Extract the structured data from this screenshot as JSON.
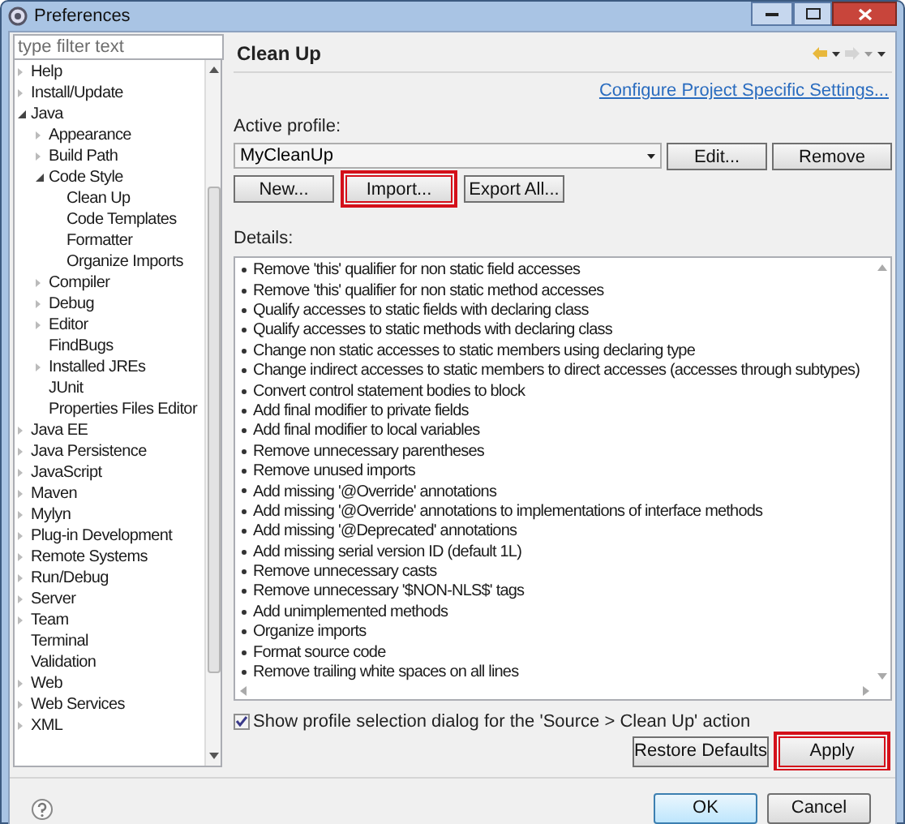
{
  "window": {
    "title": "Preferences"
  },
  "filter": {
    "placeholder": "type filter text"
  },
  "tree": [
    {
      "label": "Help",
      "expanded": false
    },
    {
      "label": "Install/Update",
      "expanded": false
    },
    {
      "label": "Java",
      "expanded": true,
      "children": [
        {
          "label": "Appearance",
          "expanded": false
        },
        {
          "label": "Build Path",
          "expanded": false
        },
        {
          "label": "Code Style",
          "expanded": true,
          "children": [
            {
              "label": "Clean Up"
            },
            {
              "label": "Code Templates"
            },
            {
              "label": "Formatter"
            },
            {
              "label": "Organize Imports"
            }
          ]
        },
        {
          "label": "Compiler",
          "expanded": false
        },
        {
          "label": "Debug",
          "expanded": false
        },
        {
          "label": "Editor",
          "expanded": false
        },
        {
          "label": "FindBugs"
        },
        {
          "label": "Installed JREs",
          "expanded": false
        },
        {
          "label": "JUnit"
        },
        {
          "label": "Properties Files Editor"
        }
      ]
    },
    {
      "label": "Java EE",
      "expanded": false
    },
    {
      "label": "Java Persistence",
      "expanded": false
    },
    {
      "label": "JavaScript",
      "expanded": false
    },
    {
      "label": "Maven",
      "expanded": false
    },
    {
      "label": "Mylyn",
      "expanded": false
    },
    {
      "label": "Plug-in Development",
      "expanded": false
    },
    {
      "label": "Remote Systems",
      "expanded": false
    },
    {
      "label": "Run/Debug",
      "expanded": false
    },
    {
      "label": "Server",
      "expanded": false
    },
    {
      "label": "Team",
      "expanded": false
    },
    {
      "label": "Terminal"
    },
    {
      "label": "Validation"
    },
    {
      "label": "Web",
      "expanded": false
    },
    {
      "label": "Web Services",
      "expanded": false
    },
    {
      "label": "XML",
      "expanded": false
    }
  ],
  "page": {
    "title": "Clean Up",
    "link": "Configure Project Specific Settings...",
    "profile_label": "Active profile:",
    "profile": "MyCleanUp",
    "profile_buttons": [
      {
        "label": "Edit...",
        "highlighted": false
      },
      {
        "label": "Remove",
        "highlighted": false
      }
    ],
    "action_buttons": [
      {
        "label": "New...",
        "highlighted": false
      },
      {
        "label": "Import...",
        "highlighted": true
      },
      {
        "label": "Export All...",
        "highlighted": false
      }
    ],
    "details_label": "Details:",
    "details": [
      "Remove 'this' qualifier for non static field accesses",
      "Remove 'this' qualifier for non static method accesses",
      "Qualify accesses to static fields with declaring class",
      "Qualify accesses to static methods with declaring class",
      "Change non static accesses to static members using declaring type",
      "Change indirect accesses to static members to direct accesses (accesses through subtypes)",
      "Convert control statement bodies to block",
      "Add final modifier to private fields",
      "Add final modifier to local variables",
      "Remove unnecessary parentheses",
      "Remove unused imports",
      "Add missing '@Override' annotations",
      "Add missing '@Override' annotations to implementations of interface methods",
      "Add missing '@Deprecated' annotations",
      "Add missing serial version ID (default 1L)",
      "Remove unnecessary casts",
      "Remove unnecessary '$NON-NLS$' tags",
      "Add unimplemented methods",
      "Organize imports",
      "Format source code",
      "Remove trailing white spaces on all lines"
    ],
    "show_dialog": {
      "label": "Show profile selection dialog for the 'Source > Clean Up' action",
      "checked": true
    },
    "page_buttons": [
      {
        "label": "Restore Defaults",
        "highlighted": false
      },
      {
        "label": "Apply",
        "highlighted": true
      }
    ]
  },
  "dialog_buttons": [
    {
      "label": "OK",
      "default": true
    },
    {
      "label": "Cancel",
      "default": false
    }
  ]
}
